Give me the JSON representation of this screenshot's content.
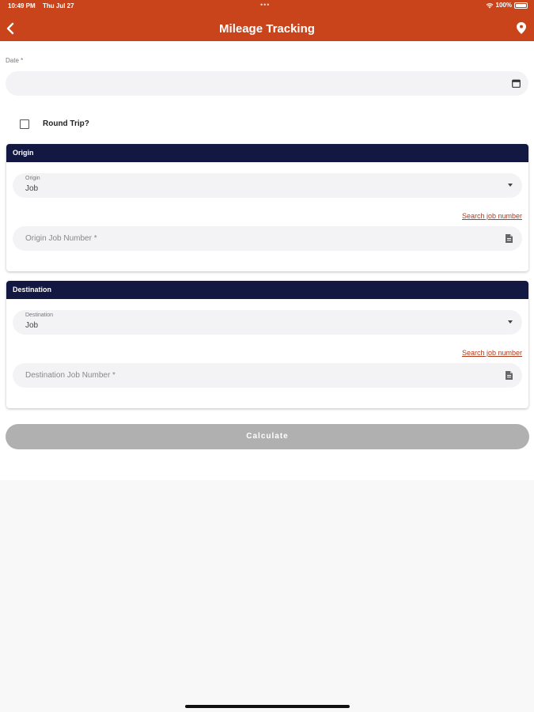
{
  "status_bar": {
    "time": "10:49 PM",
    "date": "Thu Jul 27",
    "multitask_dots": "•••",
    "battery": "100%"
  },
  "header": {
    "title": "Mileage Tracking",
    "back_icon": "chevron-left-icon",
    "location_icon": "map-pin-icon",
    "color": "#c9441b"
  },
  "form": {
    "date_label": "Date *",
    "date_value": "",
    "round_trip_label": "Round Trip?",
    "round_trip_checked": false
  },
  "origin": {
    "section_title": "Origin",
    "select_label": "Origin",
    "select_value": "Job",
    "search_link": "Search job number",
    "job_number_placeholder": "Origin Job Number *"
  },
  "destination": {
    "section_title": "Destination",
    "select_label": "Destination",
    "select_value": "Job",
    "search_link": "Search job number",
    "job_number_placeholder": "Destination Job Number *"
  },
  "actions": {
    "calculate_label": "Calculate",
    "calculate_enabled": false
  },
  "colors": {
    "section_header": "#131843",
    "link": "#b03a1c",
    "button_disabled": "#b0b0b0"
  }
}
